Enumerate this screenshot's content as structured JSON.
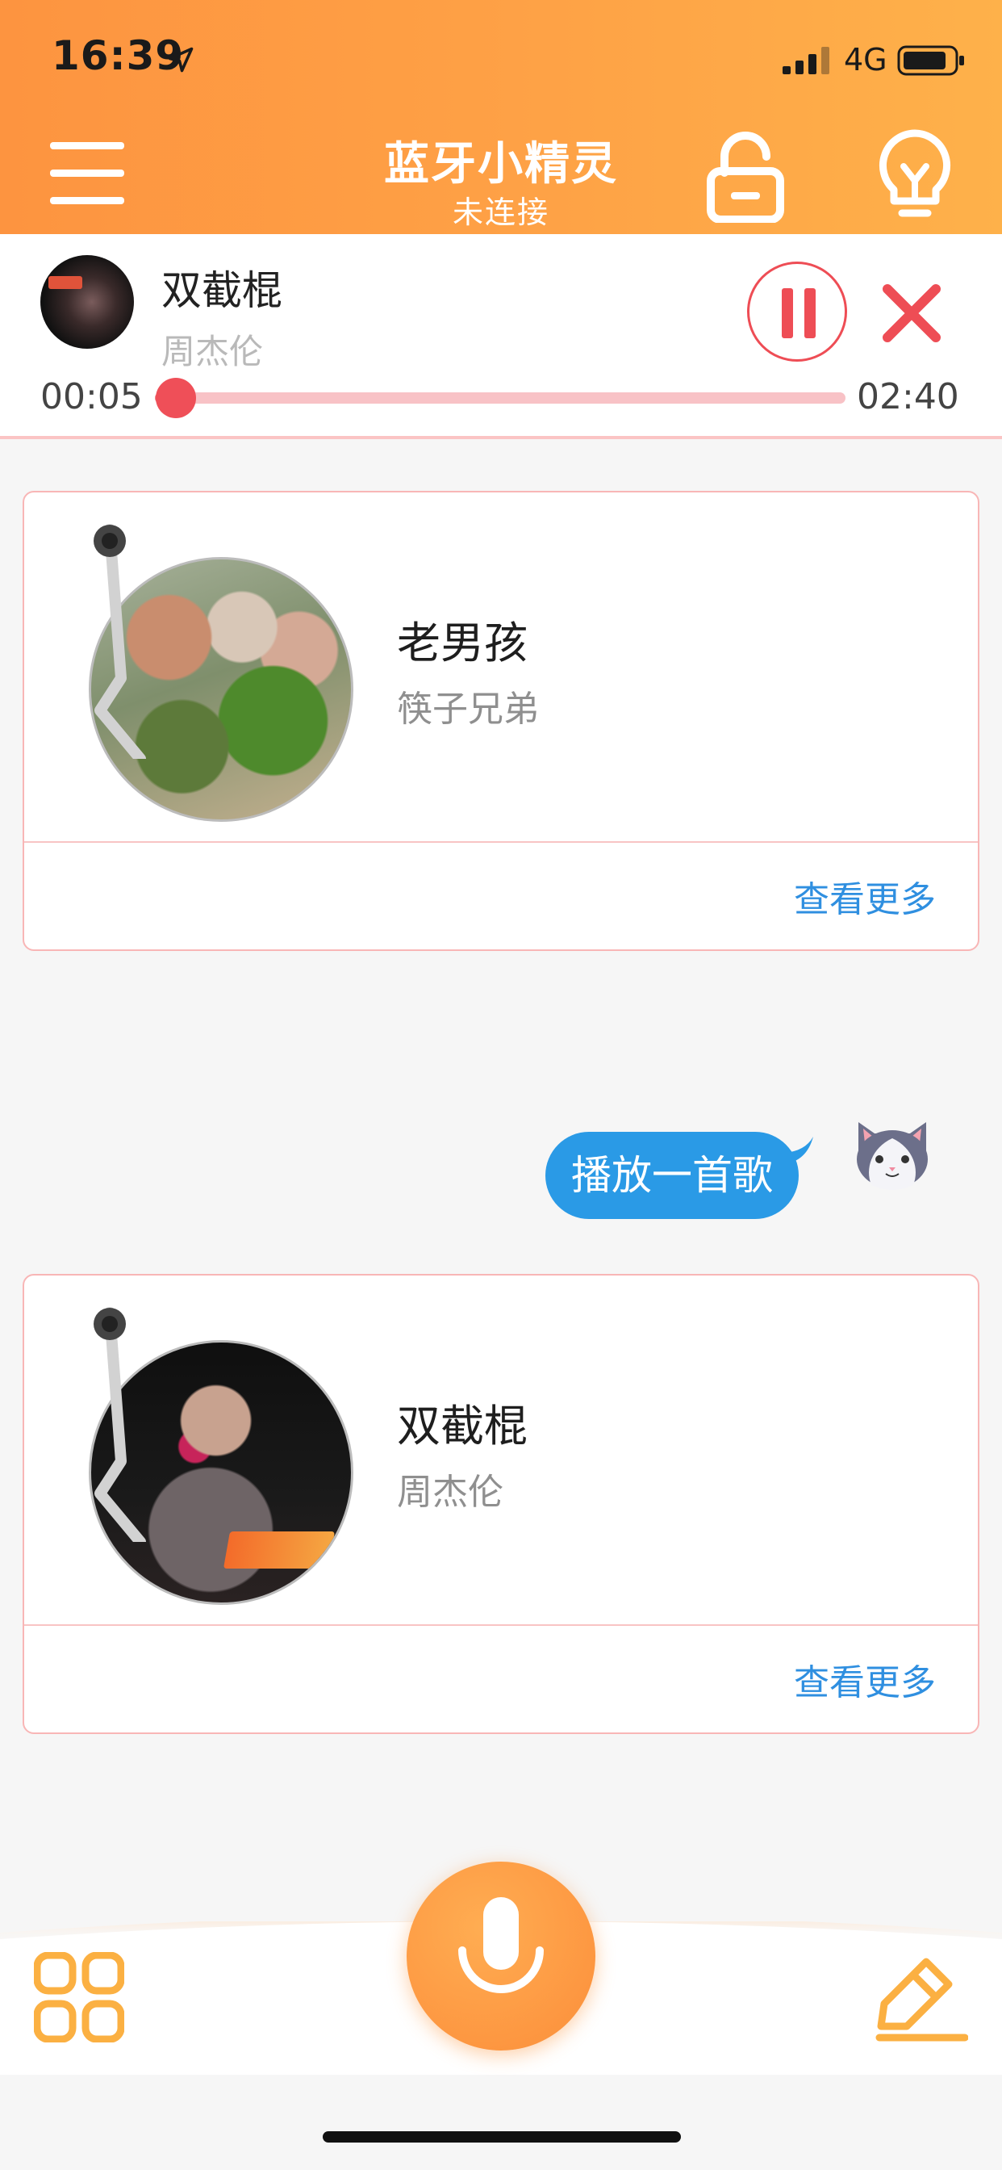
{
  "status_bar": {
    "time": "16:39",
    "network": "4G",
    "icons": [
      "location-arrow-icon",
      "signal-bars-icon",
      "battery-icon"
    ]
  },
  "header": {
    "title": "蓝牙小精灵",
    "subtitle": "未连接",
    "icons": [
      "menu-icon",
      "unlock-icon",
      "lightbulb-icon"
    ]
  },
  "now_playing": {
    "title": "双截棍",
    "artist": "周杰伦",
    "elapsed": "00:05",
    "duration": "02:40",
    "progress_fraction": 0.03,
    "state_icon": "pause-icon"
  },
  "cards": [
    {
      "title": "老男孩",
      "artist": "筷子兄弟",
      "more_label": "查看更多"
    },
    {
      "title": "双截棍",
      "artist": "周杰伦",
      "more_label": "查看更多"
    }
  ],
  "chat": {
    "user_message": "播放一首歌"
  },
  "bottom_bar": {
    "icons": [
      "grid-icon",
      "microphone-icon",
      "edit-icon"
    ]
  },
  "colors": {
    "header_gradient_start": "#fd9440",
    "header_gradient_end": "#feb14a",
    "accent_red": "#ee4d55",
    "progress_track": "#f8c2c6",
    "link_blue": "#2f8fe0",
    "bubble_blue": "#2a9ae6",
    "orange_icon": "#fbb042"
  }
}
